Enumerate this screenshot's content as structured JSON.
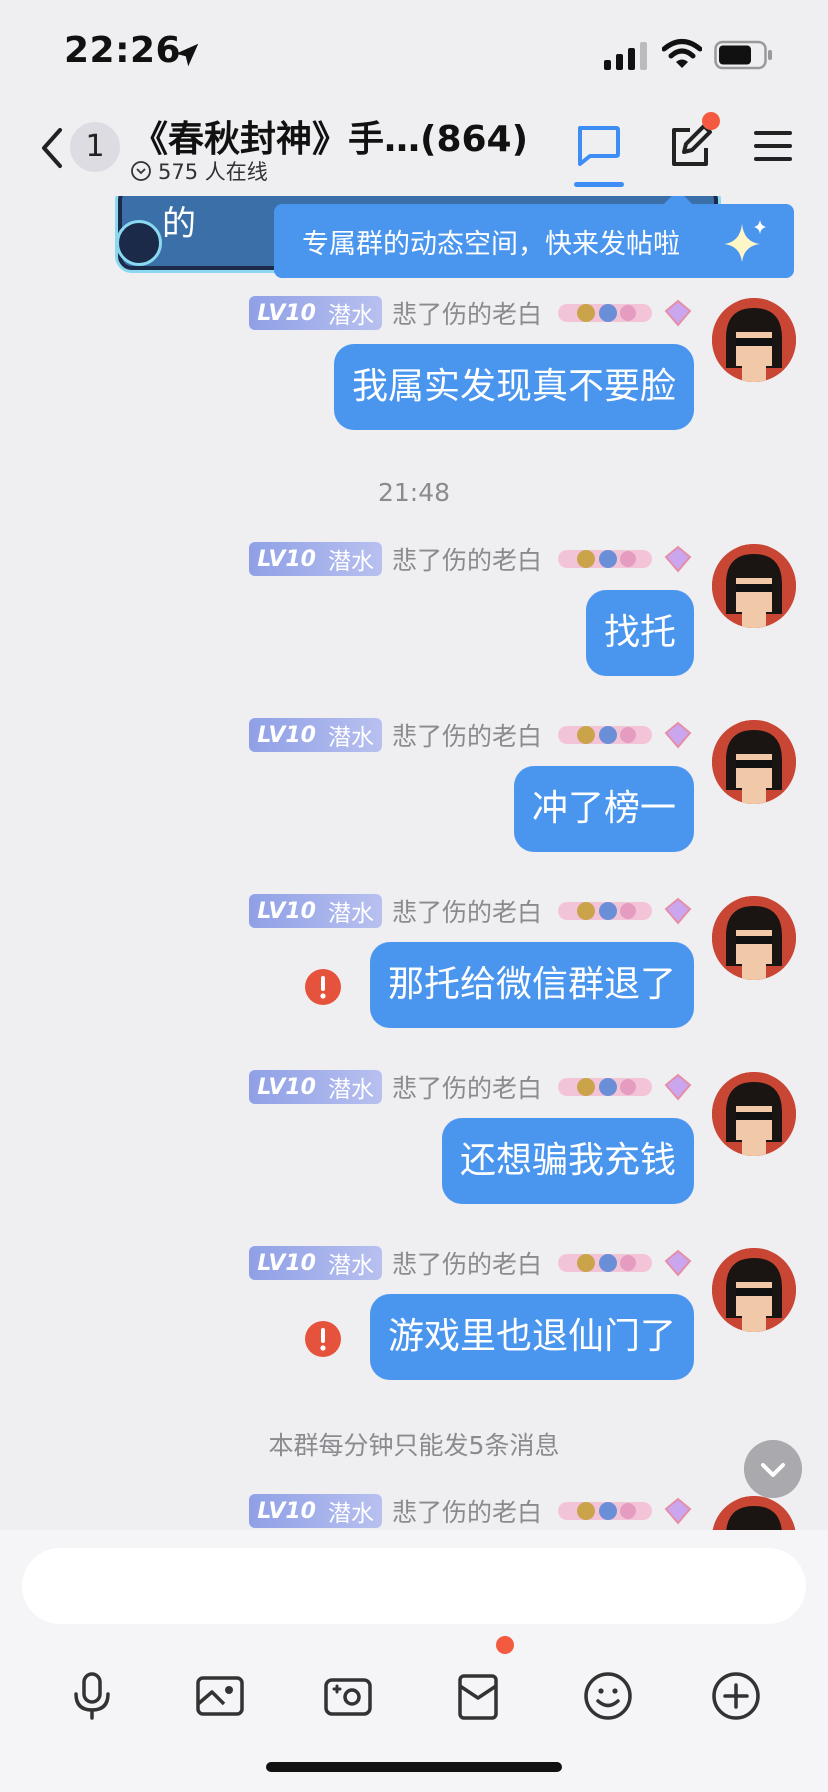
{
  "status_bar": {
    "time": "22:26"
  },
  "header": {
    "back_badge": "1",
    "title": "《春秋封神》手…(864)",
    "online_count": "575 人在线"
  },
  "pinned_card": {
    "text_fragment": "的"
  },
  "tooltip": {
    "text": "专属群的动态空间，快来发帖啦"
  },
  "messages": [
    {
      "level": "LV10",
      "level_title": "潜水",
      "sender": "悲了伤的老白",
      "text": "我属实发现真不要脸",
      "failed": false
    },
    {
      "level": "LV10",
      "level_title": "潜水",
      "sender": "悲了伤的老白",
      "text": "找托",
      "failed": false
    },
    {
      "level": "LV10",
      "level_title": "潜水",
      "sender": "悲了伤的老白",
      "text": "冲了榜一",
      "failed": false
    },
    {
      "level": "LV10",
      "level_title": "潜水",
      "sender": "悲了伤的老白",
      "text": "那托给微信群退了",
      "failed": true
    },
    {
      "level": "LV10",
      "level_title": "潜水",
      "sender": "悲了伤的老白",
      "text": "还想骗我充钱",
      "failed": false
    },
    {
      "level": "LV10",
      "level_title": "潜水",
      "sender": "悲了伤的老白",
      "text": "游戏里也退仙门了",
      "failed": true
    },
    {
      "level": "LV10",
      "level_title": "潜水",
      "sender": "悲了伤的老白",
      "text": "",
      "failed": false
    }
  ],
  "time_divider": "21:48",
  "system_note": "本群每分钟只能发5条消息",
  "input": {
    "value": "",
    "placeholder": ""
  },
  "colors": {
    "bubble": "#4a95ee",
    "accent": "#3d8df5",
    "badge_dot": "#f35a3f",
    "error": "#e5533c",
    "background": "#efeff2"
  },
  "icons": {
    "toolbar": [
      "microphone-icon",
      "image-icon",
      "camera-icon",
      "gift-icon",
      "emoji-icon",
      "plus-icon"
    ]
  }
}
